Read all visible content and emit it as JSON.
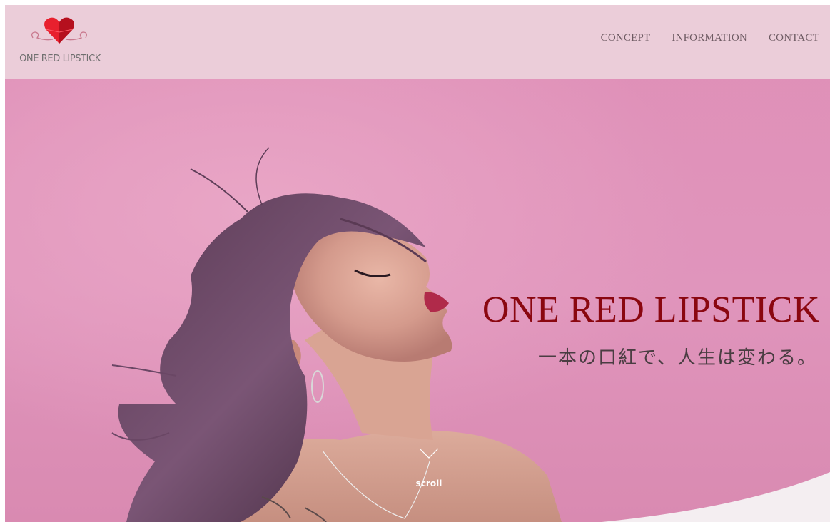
{
  "brand": {
    "name": "ONE RED LIPSTICK",
    "logo_icon": "heart-icon",
    "accent_color": "#8a0710",
    "heart_color": "#e8202e"
  },
  "nav": {
    "items": [
      {
        "label": "CONCEPT"
      },
      {
        "label": "INFORMATION"
      },
      {
        "label": "CONTACT"
      }
    ]
  },
  "hero": {
    "title": "ONE RED LIPSTICK",
    "subtitle": "一本の口紅で、人生は変わる。",
    "scroll_label": "scroll",
    "scroll_icon": "chevron-down-icon",
    "background_color": "#e18fb6"
  }
}
